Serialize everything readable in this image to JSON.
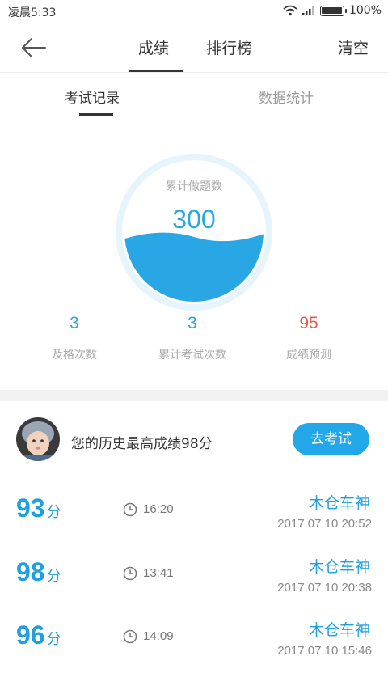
{
  "status_bar": {
    "time": "凌晨5:33",
    "battery": "100%"
  },
  "nav": {
    "tabs": [
      {
        "label": "成绩"
      },
      {
        "label": "排行榜"
      }
    ],
    "clear_label": "清空"
  },
  "subtabs": [
    {
      "label": "考试记录"
    },
    {
      "label": "数据统计"
    }
  ],
  "gauge": {
    "label": "累计做题数",
    "value": "300",
    "fill_fraction": 0.35,
    "color": "#29a7e5"
  },
  "stats": [
    {
      "value": "3",
      "label": "及格次数",
      "color": "#29a7e5"
    },
    {
      "value": "3",
      "label": "累计考试次数",
      "color": "#29a7e5"
    },
    {
      "value": "95",
      "label": "成绩预测",
      "color": "#e8584f"
    }
  ],
  "best": {
    "text": "您的历史最高成绩98分",
    "button_label": "去考试"
  },
  "records": [
    {
      "score": "93",
      "unit": "分",
      "duration": "16:20",
      "name": "木仓车神",
      "date": "2017.07.10  20:52"
    },
    {
      "score": "98",
      "unit": "分",
      "duration": "13:41",
      "name": "木仓车神",
      "date": "2017.07.10  20:38"
    },
    {
      "score": "96",
      "unit": "分",
      "duration": "14:09",
      "name": "木仓车神",
      "date": "2017.07.10  15:46"
    }
  ],
  "icons": {
    "back": "arrow-left-icon",
    "clock": "clock-icon",
    "wifi": "wifi-icon",
    "signal": "signal-icon",
    "battery": "battery-icon"
  }
}
